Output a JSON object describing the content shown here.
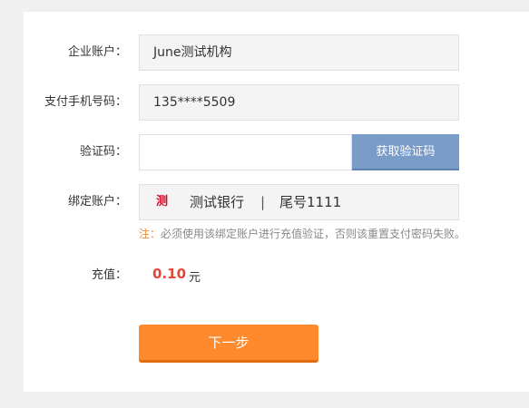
{
  "form": {
    "company_account": {
      "label": "企业账户：",
      "value": "June测试机构"
    },
    "phone": {
      "label": "支付手机号码：",
      "value": "135****5509"
    },
    "verify_code": {
      "label": "验证码：",
      "value": "",
      "button": "获取验证码"
    },
    "bound_account": {
      "label": "绑定账户：",
      "bank_logo": "测",
      "bank_name": "测试银行",
      "separator": "|",
      "tail": "尾号1111"
    },
    "note": {
      "prefix": "注：",
      "text": "必须使用该绑定账户进行充值验证，否则该重置支付密码失败。"
    },
    "recharge": {
      "label": "充值：",
      "amount": "0.10",
      "unit": "元"
    },
    "next_button": "下一步"
  },
  "colors": {
    "sms_button": "#7a9cc9",
    "next_button": "#ff8a2e",
    "amount": "#e0483a",
    "note_prefix": "#f08a30",
    "bank_logo": "#d0112b"
  }
}
